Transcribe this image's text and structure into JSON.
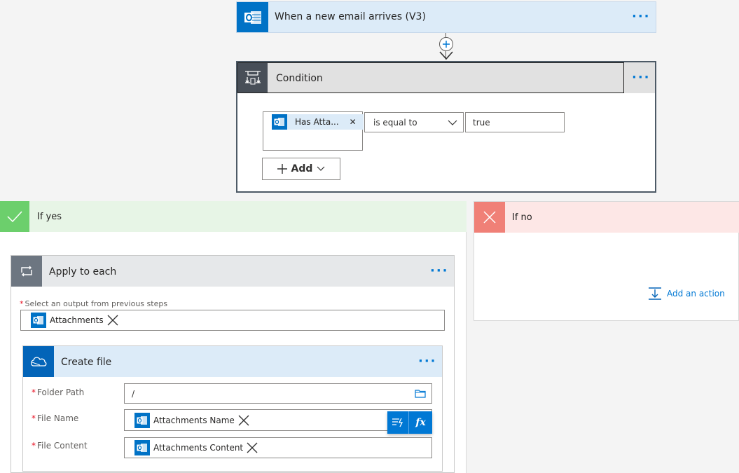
{
  "trigger": {
    "title": "When a new email arrives (V3)"
  },
  "condition": {
    "title": "Condition",
    "token_label": "Has Atta...",
    "operator": "is equal to",
    "value": "true",
    "add_label": "Add"
  },
  "branches": {
    "yes_label": "If yes",
    "no_label": "If no",
    "add_action_label": "Add an action"
  },
  "apply_each": {
    "title": "Apply to each",
    "select_label": "Select an output from previous steps",
    "token": "Attachments"
  },
  "create_file": {
    "title": "Create file",
    "folder_label": "Folder Path",
    "folder_value": "/",
    "filename_label": "File Name",
    "filename_token": "Attachments Name",
    "content_label": "File Content",
    "content_token": "Attachments Content",
    "fx_label": "fx"
  },
  "colors": {
    "outlook_blue": "#0072c6",
    "header_light_blue": "#dcebf8",
    "yes_green": "#5cb85c",
    "no_red": "#f08077",
    "condition_dark": "#484f58",
    "accent": "#0078d4"
  }
}
